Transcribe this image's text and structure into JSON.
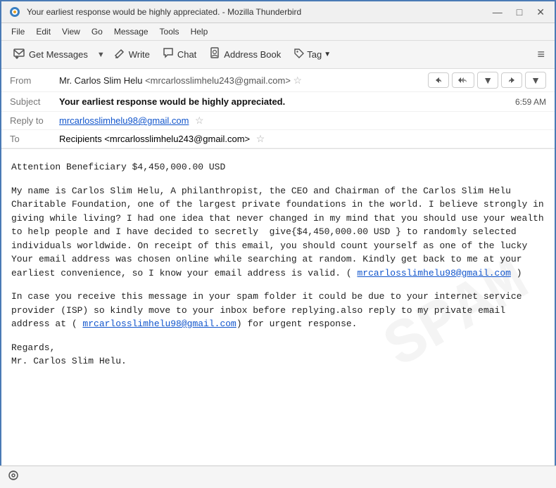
{
  "titleBar": {
    "title": "Your earliest response would be highly appreciated. - Mozilla Thunderbird",
    "icon": "🔵",
    "minBtn": "—",
    "maxBtn": "□",
    "closeBtn": "✕"
  },
  "menuBar": {
    "items": [
      "File",
      "Edit",
      "View",
      "Go",
      "Message",
      "Tools",
      "Help"
    ]
  },
  "toolbar": {
    "getMessages": "Get Messages",
    "write": "Write",
    "chat": "Chat",
    "addressBook": "Address Book",
    "tag": "Tag",
    "hamburger": "≡"
  },
  "email": {
    "fromLabel": "From",
    "fromName": "Mr. Carlos Slim Helu",
    "fromEmail": "<mrcarlosslimhelu243@gmail.com>",
    "subjectLabel": "Subject",
    "subject": "Your earliest response would be highly appreciated.",
    "time": "6:59 AM",
    "replyToLabel": "Reply to",
    "replyToEmail": "mrcarlosslimhelu98@gmail.com",
    "toLabel": "To",
    "toValue": "Recipients <mrcarlosslimhelu243@gmail.com>"
  },
  "body": {
    "line1": "Attention Beneficiary $4,450,000.00 USD",
    "para1": "My name is Carlos Slim Helu, A philanthropist, the CEO and Chairman of the Carlos Slim Helu Charitable Foundation, one of the largest private foundations in the world. I believe strongly in giving while living? I had one idea that never changed in my mind that you should use your wealth to help people and I have decided to secretly  give{$4,450,000.00 USD } to randomly selected individuals worldwide. On receipt of this email, you should count yourself as one of the lucky Your email address was chosen online while searching at random. Kindly get back to me at your earliest convenience, so I know your email address is valid. ( mrcarlosslimhelu98@gmail.com )",
    "para1_link": "mrcarlosslimhelu98@gmail.com",
    "para2": "In case you receive this message in your spam folder it could be due to your internet service provider (ISP) so kindly move to your inbox before replying.also reply to my private email address at ( mrcarlosslimhelu98@gmail.com) for urgent response.",
    "para2_link": "mrcarlosslimhelu98@gmail.com",
    "closing": "Regards,\nMr. Carlos Slim Helu."
  },
  "statusBar": {
    "icon": "📡",
    "text": ""
  }
}
